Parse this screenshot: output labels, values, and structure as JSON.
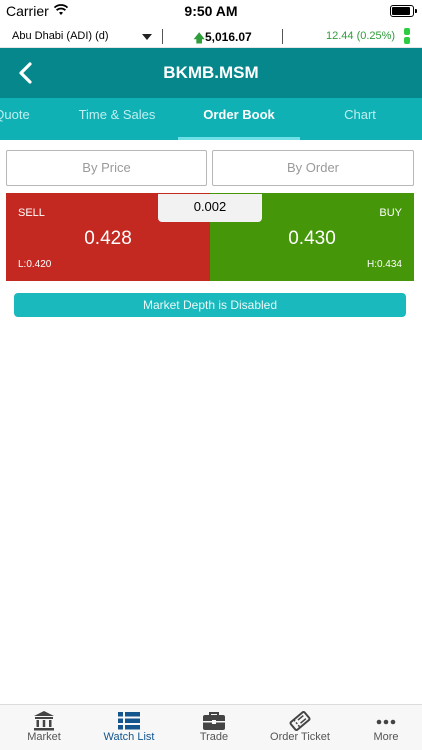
{
  "status_bar": {
    "carrier": "Carrier",
    "time": "9:50 AM"
  },
  "ticker": {
    "market": "Abu Dhabi (ADI) (d)",
    "index_value": "5,016.07",
    "index_change": "12.44 (0.25%)",
    "up_color": "#2e9d3a"
  },
  "header": {
    "title": "BKMB.MSM",
    "bg_color": "#06878b"
  },
  "tabs": [
    {
      "label": "Quote",
      "active": false
    },
    {
      "label": "Time & Sales",
      "active": false
    },
    {
      "label": "Order Book",
      "active": true
    },
    {
      "label": "Chart",
      "active": false
    }
  ],
  "segments": {
    "by_price": "By Price",
    "by_order": "By Order"
  },
  "order_book": {
    "spread": "0.002",
    "sell": {
      "label": "SELL",
      "price": "0.428",
      "limit": "L:0.420",
      "color": "#c32821"
    },
    "buy": {
      "label": "BUY",
      "price": "0.430",
      "limit": "H:0.434",
      "color": "#459609"
    }
  },
  "notice": "Market Depth is Disabled",
  "bottom_nav": [
    {
      "label": "Market",
      "icon": "bank-icon",
      "active": false
    },
    {
      "label": "Watch List",
      "icon": "list-icon",
      "active": true
    },
    {
      "label": "Trade",
      "icon": "briefcase-icon",
      "active": false
    },
    {
      "label": "Order Ticket",
      "icon": "ticket-icon",
      "active": false
    },
    {
      "label": "More",
      "icon": "more-dots-icon",
      "active": false
    }
  ]
}
